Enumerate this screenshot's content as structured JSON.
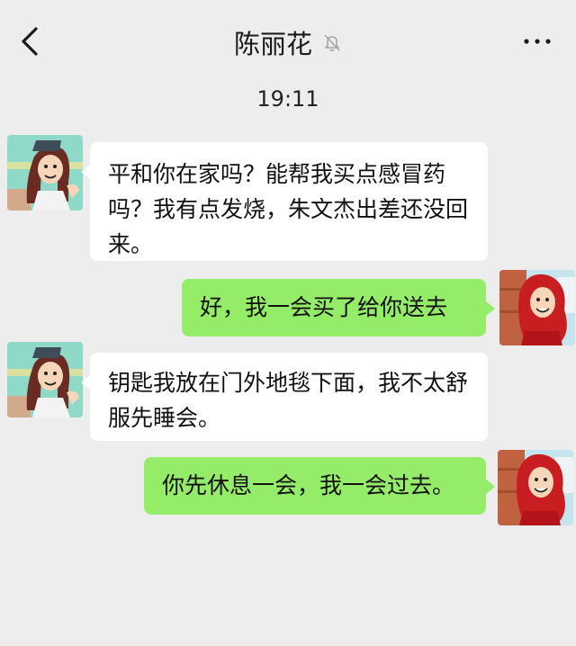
{
  "header": {
    "title": "陈丽花",
    "back_icon": "chevron-left-icon",
    "mute_icon": "bell-off-icon",
    "more_icon": "ellipsis-icon"
  },
  "time_label": "19:11",
  "messages": [
    {
      "side": "in",
      "sender_avatar": "avatar-chen-lihua",
      "text": "平和你在家吗？能帮我买点感冒药吗？我有点发烧，朱文杰出差还没回来。"
    },
    {
      "side": "out",
      "sender_avatar": "avatar-self",
      "text": "好，我一会买了给你送去"
    },
    {
      "side": "in",
      "sender_avatar": "avatar-chen-lihua",
      "text": "钥匙我放在门外地毯下面，我不太舒服先睡会。"
    },
    {
      "side": "out",
      "sender_avatar": "avatar-self",
      "text": "你先休息一会，我一会过去。"
    }
  ],
  "colors": {
    "background": "#ededed",
    "incoming_bubble": "#ffffff",
    "outgoing_bubble": "#95ec69"
  }
}
